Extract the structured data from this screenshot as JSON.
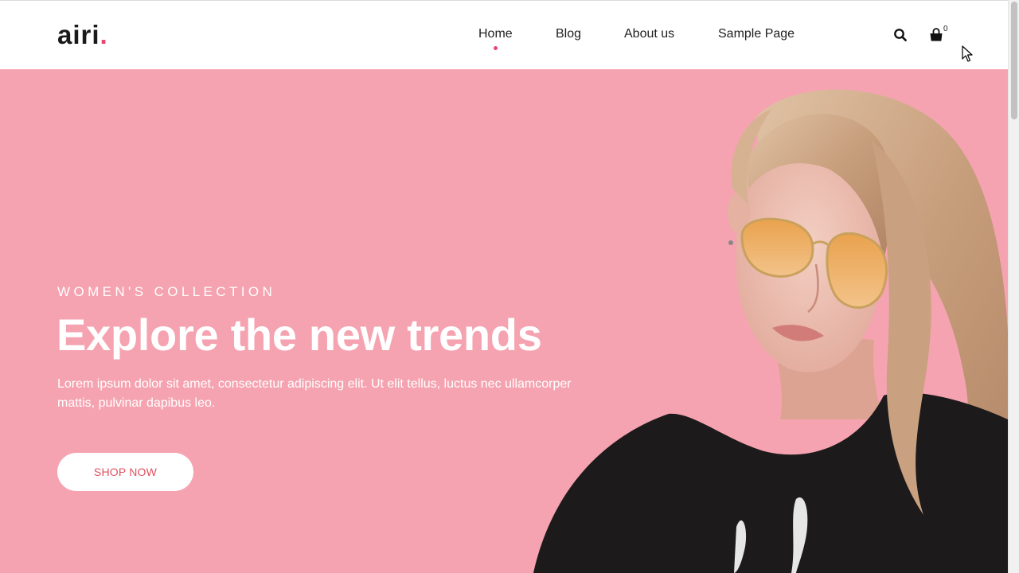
{
  "brand": {
    "name": "airi",
    "dot": "."
  },
  "nav": {
    "items": [
      {
        "label": "Home",
        "active": true
      },
      {
        "label": "Blog",
        "active": false
      },
      {
        "label": "About us",
        "active": false
      },
      {
        "label": "Sample Page",
        "active": false
      }
    ]
  },
  "header_icons": {
    "search": "search-icon",
    "cart": "shopping-bag-icon",
    "cart_count": "0"
  },
  "hero": {
    "subtitle": "WOMEN'S COLLECTION",
    "headline": "Explore the new trends",
    "description": "Lorem ipsum dolor sit amet, consectetur adipiscing elit. Ut elit tellus, luctus nec ullamcorper mattis, pulvinar dapibus leo.",
    "button_label": "SHOP NOW",
    "image": "woman-with-orange-sunglasses-photo"
  },
  "colors": {
    "accent": "#e8466b",
    "hero_background": "#f5a3b0",
    "button_text": "#e0525f",
    "text_dark": "#1e1e1e"
  }
}
